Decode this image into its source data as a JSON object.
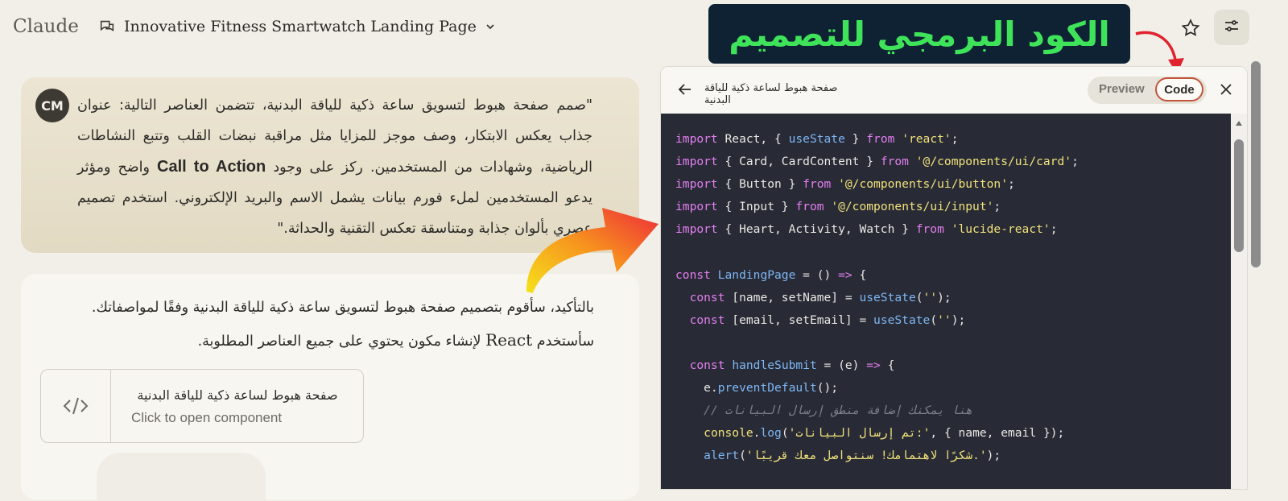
{
  "app": {
    "logo": "Claude"
  },
  "header": {
    "chat_title": "Innovative Fitness Smartwatch Landing Page"
  },
  "annotation": {
    "banner_text": "الكود البرمجي للتصميم",
    "colors": {
      "banner_bg": "#0e2233",
      "banner_text": "#3fe35a"
    }
  },
  "user_message": {
    "avatar_initials": "CM",
    "text_before": "\"صمم صفحة هبوط لتسويق ساعة ذكية للياقة البدنية، تتضمن العناصر التالية: عنوان جذاب يعكس الابتكار، وصف موجز للمزايا مثل مراقبة نبضات القلب وتتبع النشاطات الرياضية، وشهادات من المستخدمين. ركز على وجود ",
    "emphasis": "Call to Action",
    "text_after": " واضح ومؤثر يدعو المستخدمين لملء فورم بيانات يشمل الاسم والبريد الإلكتروني. استخدم تصميم عصري بألوان جذابة ومتناسقة تعكس التقنية والحداثة.\""
  },
  "assistant_message": {
    "line1": "بالتأكيد، سأقوم بتصميم صفحة هبوط لتسويق ساعة ذكية للياقة البدنية وفقًا لمواصفاتك.",
    "line2_before": "سأستخدم ",
    "line2_latin": "React",
    "line2_after": " لإنشاء مكون يحتوي على جميع العناصر المطلوبة.",
    "component_card": {
      "title": "صفحة هبوط لساعة ذكية للياقة البدنية",
      "subtitle": "Click to open component"
    }
  },
  "artifact_panel": {
    "title": "صفحة هبوط لساعة ذكية للياقة البدنية",
    "tab_preview": "Preview",
    "tab_code": "Code",
    "active_tab": "Code",
    "code_lines": [
      "import React, { useState } from 'react';",
      "import { Card, CardContent } from '@/components/ui/card';",
      "import { Button } from '@/components/ui/button';",
      "import { Input } from '@/components/ui/input';",
      "import { Heart, Activity, Watch } from 'lucide-react';",
      "",
      "const LandingPage = () => {",
      "  const [name, setName] = useState('');",
      "  const [email, setEmail] = useState('');",
      "",
      "  const handleSubmit = (e) => {",
      "    e.preventDefault();",
      "    // هنا يمكنك إضافة منطق إرسال البيانات",
      "    console.log('تم إرسال البيانات:', { name, email });",
      "    alert('شكرًا لاهتمامك! سنتواصل معك قريبًا.');"
    ]
  },
  "icons": [
    "chat-bubble-icon",
    "chevron-down-icon",
    "star-icon",
    "sliders-icon",
    "code-icon",
    "arrow-left-icon",
    "close-icon",
    "red-pointer-arrow-icon",
    "gradient-arrow-icon"
  ]
}
